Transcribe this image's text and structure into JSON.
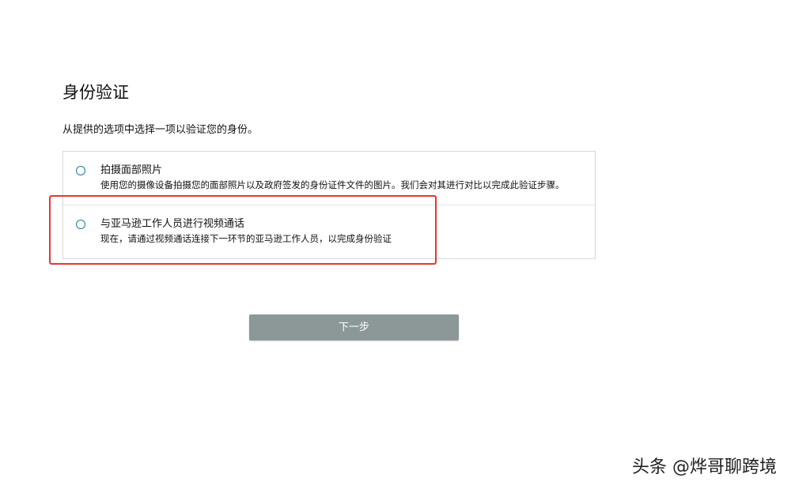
{
  "page": {
    "title": "身份验证",
    "instruction": "从提供的选项中选择一项以验证您的身份。"
  },
  "options": [
    {
      "title": "拍摄面部照片",
      "description": "使用您的摄像设备拍摄您的面部照片以及政府签发的身份证件文件的图片。我们会对其进行对比以完成此验证步骤。",
      "selected": false
    },
    {
      "title": "与亚马逊工作人员进行视频通话",
      "description": "现在，请通过视频通话连接下一环节的亚马逊工作人员，以完成身份验证",
      "selected": false
    }
  ],
  "actions": {
    "next_label": "下一步"
  },
  "watermark": {
    "text": "头条 @烨哥聊跨境"
  },
  "colors": {
    "radio_border": "#1a7c9c",
    "button_bg": "#8c9898",
    "highlight_border": "#e8352e",
    "options_border": "#d5d9d9"
  }
}
